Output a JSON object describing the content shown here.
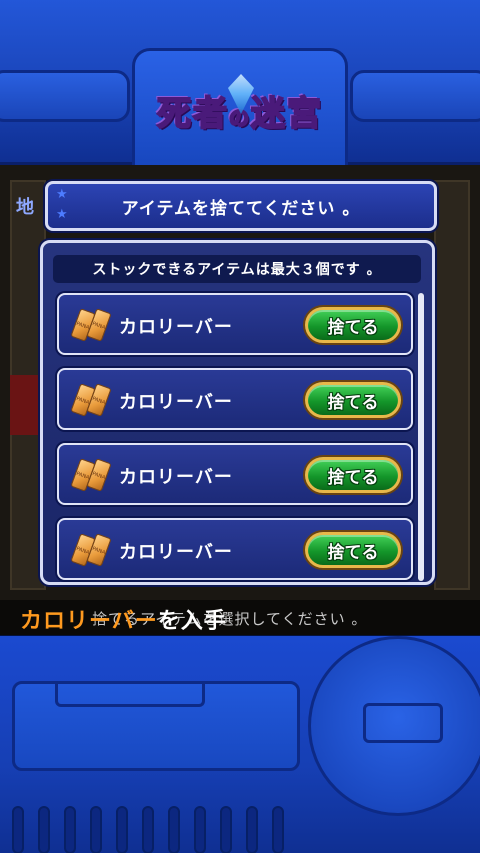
{
  "logo": {
    "main": "死者",
    "particle": "の",
    "rest": "迷宮"
  },
  "background": {
    "map_label": "地"
  },
  "title_bar": {
    "text": "アイテムを捨ててください 。"
  },
  "dialog": {
    "header": "ストックできるアイテムは最大３個です 。",
    "items": [
      {
        "name": "カロリーバー",
        "icon": "calorie-bar-icon",
        "icon_text": "PANA",
        "button": "捨てる"
      },
      {
        "name": "カロリーバー",
        "icon": "calorie-bar-icon",
        "icon_text": "PANA",
        "button": "捨てる"
      },
      {
        "name": "カロリーバー",
        "icon": "calorie-bar-icon",
        "icon_text": "PANA",
        "button": "捨てる"
      },
      {
        "name": "カロリーバー",
        "icon": "calorie-bar-icon",
        "icon_text": "PANA",
        "button": "捨てる"
      }
    ]
  },
  "message": {
    "highlight": "カロリーバー",
    "rest": "を入手",
    "sub": "捨てるアイテムを選択してください 。"
  },
  "colors": {
    "frame_blue": "#1a44b8",
    "dialog_navy": "#1c2a78",
    "button_green": "#14962a",
    "button_gold": "#e8b84a",
    "highlight_orange": "#ff9a1f"
  }
}
